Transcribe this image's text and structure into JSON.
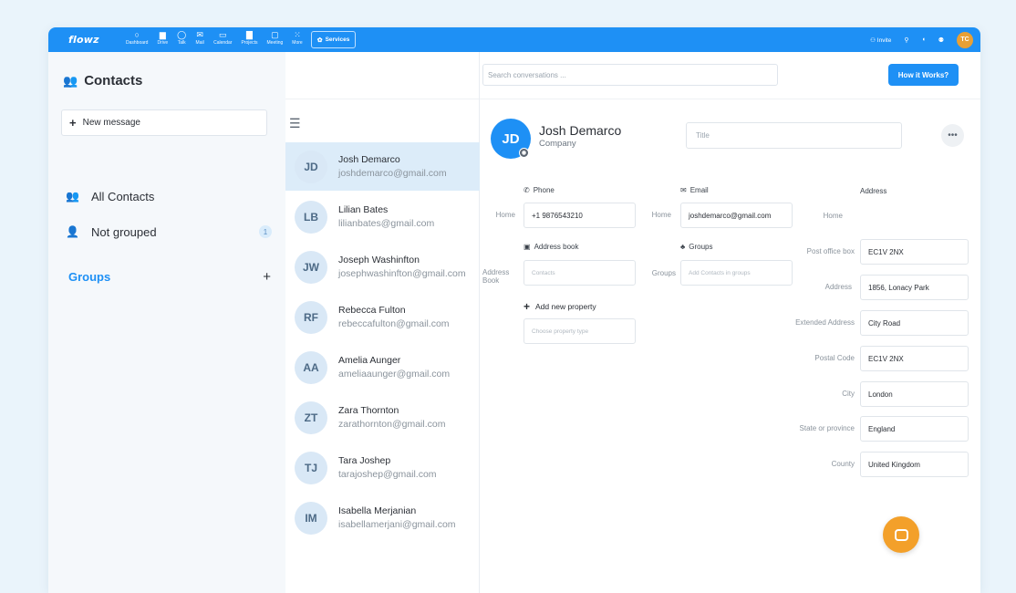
{
  "topbar": {
    "logo": "flowz",
    "nav": [
      {
        "icon": "circle",
        "label": "Dashboard"
      },
      {
        "icon": "folder",
        "label": "Drive"
      },
      {
        "icon": "chat",
        "label": "Talk"
      },
      {
        "icon": "mail",
        "label": "Mail"
      },
      {
        "icon": "calendar",
        "label": "Calendar"
      },
      {
        "icon": "briefcase",
        "label": "Projects"
      },
      {
        "icon": "monitor",
        "label": "Meeting"
      },
      {
        "icon": "grid",
        "label": "More"
      }
    ],
    "services_label": "Services",
    "invite_label": "Invite",
    "user_initials": "TC"
  },
  "sidebar": {
    "title": "Contacts",
    "new_message": "New message",
    "items": [
      {
        "label": "All Contacts",
        "icon": "users-icon"
      },
      {
        "label": "Not grouped",
        "icon": "user-icon",
        "count": "1"
      }
    ],
    "groups_label": "Groups"
  },
  "search": {
    "placeholder": "Search conversations ..."
  },
  "how_it_works": "How it Works?",
  "contacts": [
    {
      "initials": "JD",
      "name": "Josh Demarco",
      "email": "joshdemarco@gmail.com"
    },
    {
      "initials": "LB",
      "name": "Lilian Bates",
      "email": "lilianbates@gmail.com"
    },
    {
      "initials": "JW",
      "name": "Joseph Washinfton",
      "email": "josephwashinfton@gmail.com"
    },
    {
      "initials": "RF",
      "name": "Rebecca Fulton",
      "email": "rebeccafulton@gmail.com"
    },
    {
      "initials": "AA",
      "name": "Amelia Aunger",
      "email": "ameliaaunger@gmail.com"
    },
    {
      "initials": "ZT",
      "name": "Zara Thornton",
      "email": "zarathornton@gmail.com"
    },
    {
      "initials": "TJ",
      "name": "Tara Joshep",
      "email": "tarajoshep@gmail.com"
    },
    {
      "initials": "IM",
      "name": "Isabella Merjanian",
      "email": "isabellamerjani@gmail.com"
    }
  ],
  "detail": {
    "initials": "JD",
    "name": "Josh Demarco",
    "company": "Company",
    "title_placeholder": "Title",
    "more": "•••",
    "phone": {
      "header": "Phone",
      "label": "Home",
      "value": "+1 9876543210"
    },
    "email": {
      "header": "Email",
      "label": "Home",
      "value": "joshdemarco@gmail.com"
    },
    "address_book": {
      "header": "Address book",
      "label_line1": "Address",
      "label_line2": "Book",
      "placeholder": "Contacts"
    },
    "groups": {
      "header": "Groups",
      "label": "Groups",
      "placeholder": "Add Contacts in groups"
    },
    "add_property": "Add new property",
    "property_placeholder": "Choose property type",
    "address": {
      "header": "Address",
      "home_label": "Home",
      "fields": [
        {
          "label": "Post office box",
          "value": "EC1V 2NX"
        },
        {
          "label": "Address",
          "value": "1856, Lonacy Park"
        },
        {
          "label": "Extended Address",
          "value": "City Road"
        },
        {
          "label": "Postal Code",
          "value": "EC1V 2NX"
        },
        {
          "label": "City",
          "value": "London"
        },
        {
          "label": "State or province",
          "value": "England"
        },
        {
          "label": "County",
          "value": "United Kingdom"
        }
      ]
    }
  },
  "colors": {
    "accent": "#1e90f5",
    "chat": "#f3a02a",
    "avatar": "#e8a035"
  }
}
